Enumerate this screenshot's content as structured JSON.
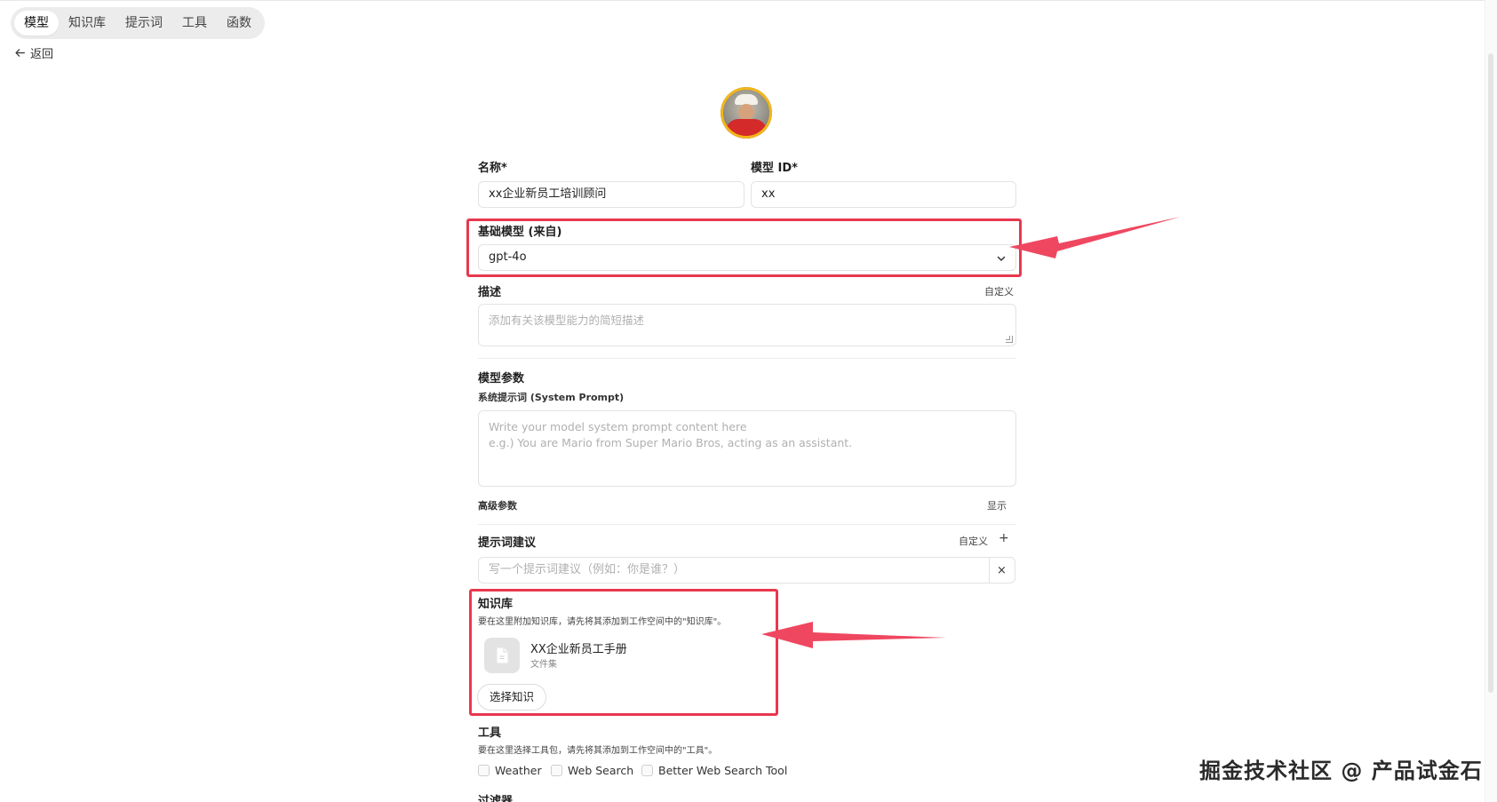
{
  "nav": {
    "tabs": [
      {
        "label": "模型",
        "active": true
      },
      {
        "label": "知识库",
        "active": false
      },
      {
        "label": "提示词",
        "active": false
      },
      {
        "label": "工具",
        "active": false
      },
      {
        "label": "函数",
        "active": false
      }
    ],
    "back_label": "返回"
  },
  "form": {
    "name_label": "名称*",
    "name_value": "xx企业新员工培训顾问",
    "model_id_label": "模型 ID*",
    "model_id_value": "xx",
    "base_model_label": "基础模型 (来自)",
    "base_model_value": "gpt-4o",
    "description_label": "描述",
    "description_custom": "自定义",
    "description_placeholder": "添加有关该模型能力的简短描述",
    "params_label": "模型参数",
    "system_prompt_label": "系统提示词 (System Prompt)",
    "system_prompt_placeholder_line1": "Write your model system prompt content here",
    "system_prompt_placeholder_line2": "e.g.) You are Mario from Super Mario Bros, acting as an assistant.",
    "advanced_label": "高级参数",
    "advanced_toggle": "显示",
    "suggestions_label": "提示词建议",
    "suggestions_custom": "自定义",
    "suggestions_add": "+",
    "suggestion_placeholder": "写一个提示词建议（例如：你是谁？）",
    "suggestion_clear": "×",
    "knowledge_label": "知识库",
    "knowledge_hint": "要在这里附加知识库，请先将其添加到工作空间中的\"知识库\"。",
    "knowledge_items": [
      {
        "title": "XX企业新员工手册",
        "subtitle": "文件集"
      }
    ],
    "select_knowledge_button": "选择知识",
    "tools_label": "工具",
    "tools_hint": "要在这里选择工具包，请先将其添加到工作空间中的\"工具\"。",
    "tools": [
      {
        "label": "Weather",
        "checked": false
      },
      {
        "label": "Web Search",
        "checked": false
      },
      {
        "label": "Better Web Search Tool",
        "checked": false
      }
    ],
    "filters_label": "过滤器"
  },
  "watermark": "掘金技术社区 @ 产品试金石",
  "colors": {
    "highlight": "#e8384f",
    "arrow": "#ef4760",
    "tab_bar": "#ececec"
  }
}
